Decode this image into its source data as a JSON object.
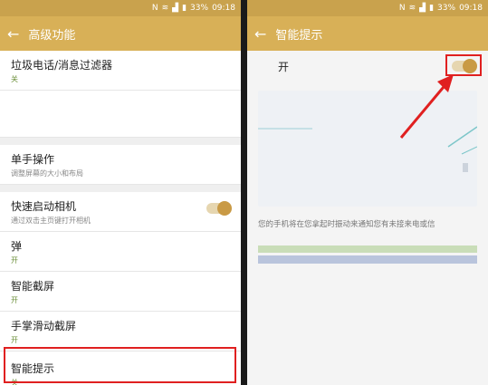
{
  "status": {
    "battery": "33%",
    "time": "09:18"
  },
  "left": {
    "title": "高级功能",
    "items": [
      {
        "title": "垃圾电话/消息过滤器",
        "sub": "关"
      },
      {
        "title": "单手操作",
        "sub": "调整屏幕的大小和布局"
      },
      {
        "title": "快速启动相机",
        "sub": "通过双击主页键打开相机"
      },
      {
        "title": "弹",
        "sub": "开"
      },
      {
        "title": "智能截屏",
        "sub": "开"
      },
      {
        "title": "手掌滑动截屏",
        "sub": "开"
      },
      {
        "title": "智能提示",
        "sub": "关"
      }
    ]
  },
  "right": {
    "title": "智能提示",
    "on_label": "开",
    "description": "您的手机将在您拿起时振动来通知您有未接来电或信"
  },
  "colors": {
    "accent": "#d8b057",
    "highlight": "#e02020",
    "toggle_knob": "#c99a45"
  }
}
